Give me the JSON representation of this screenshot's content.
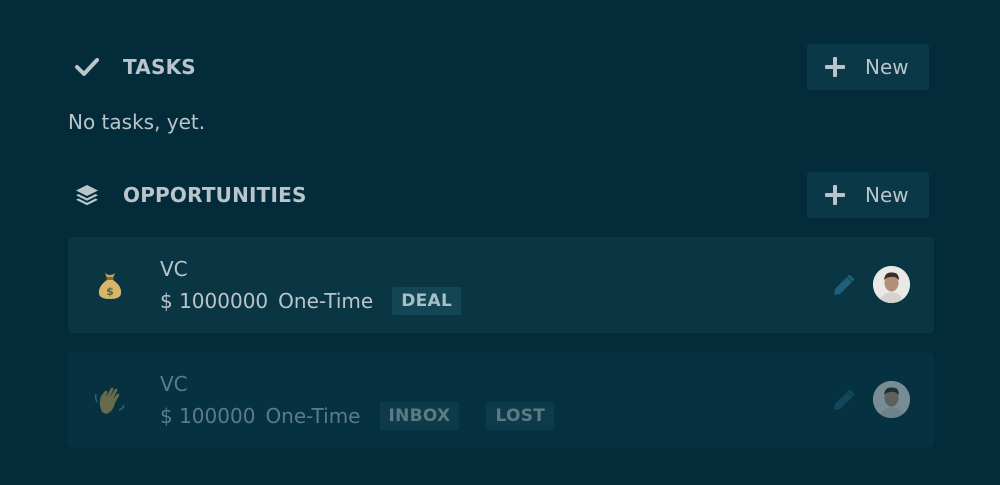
{
  "tasks": {
    "title": "TASKS",
    "new_label": "New",
    "empty_text": "No tasks, yet.",
    "icon": "checkmark-icon"
  },
  "opportunities": {
    "title": "OPPORTUNITIES",
    "new_label": "New",
    "icon": "layers-icon",
    "items": [
      {
        "title": "VC",
        "amount": "$ 1000000",
        "frequency": "One-Time",
        "badges": [
          "DEAL"
        ],
        "emoji_icon": "money-bag-icon",
        "faded": false
      },
      {
        "title": "VC",
        "amount": "$ 100000",
        "frequency": "One-Time",
        "badges": [
          "INBOX",
          "LOST"
        ],
        "emoji_icon": "waving-hand-icon",
        "faded": true
      }
    ]
  },
  "colors": {
    "background": "#032b39",
    "card": "#0a3644",
    "button": "#0b3847",
    "text": "#b9c5ca",
    "edit_icon": "#1f5f78"
  }
}
